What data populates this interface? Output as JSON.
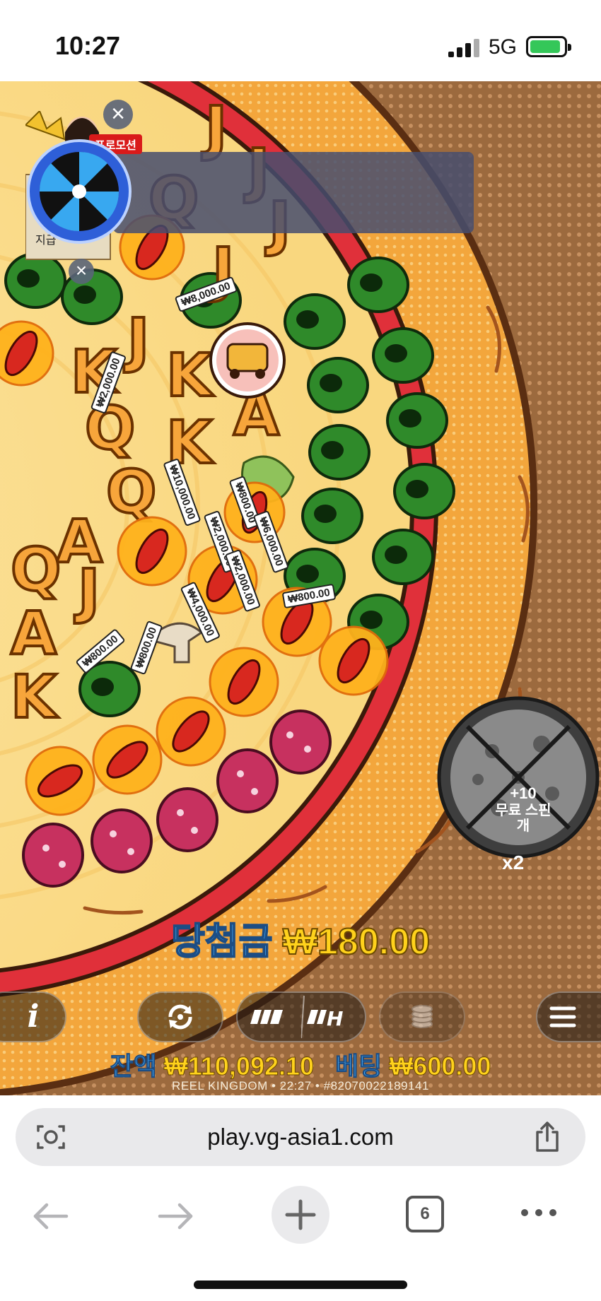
{
  "status_bar": {
    "time": "10:27",
    "network": "5G"
  },
  "promo": {
    "tag": "프로모션",
    "label": "지급"
  },
  "free_spins_badge": {
    "plus": "+10",
    "label_line1": "무료 스핀",
    "label_line2": "개",
    "multiplier": "x2"
  },
  "win": {
    "label": "당첨금",
    "amount": "₩180.00"
  },
  "balance": {
    "label": "잔액",
    "amount": "₩110,092.10"
  },
  "bet": {
    "label": "베팅",
    "amount": "₩600.00"
  },
  "footer": {
    "text": "REEL KINGDOM • 22:27 • #82070022189141"
  },
  "prize_tags": [
    "₩8,000.00",
    "₩2,000.00",
    "₩10,000.00",
    "₩800.00",
    "₩6,000.00",
    "₩2,000.00",
    "₩2,000.00",
    "₩800.00",
    "₩4,000.00",
    "₩800.00",
    "₩800.00"
  ],
  "symbols": {
    "letters": [
      "J",
      "K",
      "Q",
      "A",
      "J",
      "K",
      "Q",
      "A"
    ]
  },
  "colors": {
    "crust": "#f3a63c",
    "sauce": "#e0303a",
    "cheese": "#fbe39a",
    "olive": "#2f8a2a",
    "salami": "#c7315f",
    "win_label": "#4ab4ff",
    "win_amount": "#ffd21c"
  },
  "browser": {
    "url": "play.vg-asia1.com",
    "tab_count": "6"
  },
  "icons": {
    "info": "i",
    "autoplay": "autoplay-icon",
    "turbo": "turbo-icon",
    "coins": "coins-icon",
    "menu": "hamburger-icon"
  }
}
